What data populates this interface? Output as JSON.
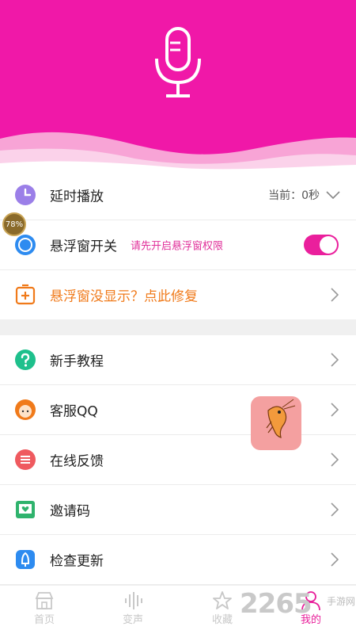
{
  "colors": {
    "accent": "#f018a8",
    "toggle_on": "#ea1f9c",
    "hint": "#e0309a",
    "repair": "#f07a1a",
    "tab_active": "#e81f9a",
    "tab_inactive": "#c8c8c8"
  },
  "header": {
    "icon": "microphone-icon"
  },
  "settings": {
    "delay": {
      "label": "延时播放",
      "value": "当前：0秒",
      "icon": "clock-icon"
    },
    "float": {
      "label": "悬浮窗开关",
      "hint": "请先开启悬浮窗权限",
      "icon": "circle-icon",
      "toggle_on": true
    },
    "repair": {
      "label": "悬浮窗没显示？点此修复",
      "icon": "repair-icon"
    }
  },
  "menu": [
    {
      "label": "新手教程",
      "icon": "question-icon"
    },
    {
      "label": "客服QQ",
      "icon": "avatar-icon"
    },
    {
      "label": "在线反馈",
      "icon": "feedback-icon"
    },
    {
      "label": "邀请码",
      "icon": "invite-icon"
    },
    {
      "label": "检查更新",
      "icon": "update-icon"
    }
  ],
  "badge": {
    "text": "78%"
  },
  "tabs": [
    {
      "label": "首页",
      "icon": "home-icon"
    },
    {
      "label": "变声",
      "icon": "waveform-icon"
    },
    {
      "label": "收藏",
      "icon": "star-icon"
    },
    {
      "label": "我的",
      "icon": "user-icon",
      "active": true
    }
  ],
  "watermark": {
    "number": "2265",
    "text": "手游网"
  }
}
